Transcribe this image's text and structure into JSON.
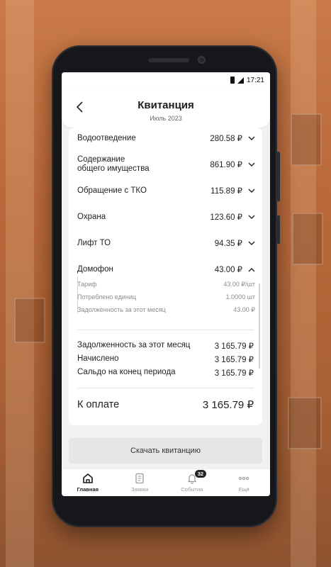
{
  "status_bar": {
    "time": "17:21"
  },
  "header": {
    "title": "Квитанция",
    "subtitle": "Июль 2023"
  },
  "services": [
    {
      "label": "Водоотведение",
      "amount": "280.58 ₽"
    },
    {
      "label": "Содержание\nобщего имущества",
      "amount": "861.90 ₽"
    },
    {
      "label": "Обращение с ТКО",
      "amount": "115.89 ₽"
    },
    {
      "label": "Охрана",
      "amount": "123.60 ₽"
    },
    {
      "label": "Лифт ТО",
      "amount": "94.35 ₽"
    },
    {
      "label": "Домофон",
      "amount": "43.00 ₽",
      "expanded": true
    }
  ],
  "details": [
    {
      "label": "Тариф",
      "value": "43.00 ₽/шт"
    },
    {
      "label": "Потреблено единиц",
      "value": "1.0000 шт"
    },
    {
      "label": "Задолженность за этот месяц",
      "value": "43.00 ₽"
    }
  ],
  "summary": [
    {
      "label": "Задолженность за этот месяц",
      "value": "3 165.79 ₽"
    },
    {
      "label": "Начислено",
      "value": "3 165.79 ₽"
    },
    {
      "label": "Сальдо на конец периода",
      "value": "3 165.79 ₽"
    }
  ],
  "total": {
    "label": "К оплате",
    "value": "3 165.79 ₽"
  },
  "download_label": "Скачать квитанцию",
  "tabs": [
    {
      "label": "Главная",
      "icon": "home-icon",
      "active": true
    },
    {
      "label": "Заявки",
      "icon": "document-icon"
    },
    {
      "label": "События",
      "icon": "bell-icon",
      "badge": "32"
    },
    {
      "label": "Ещё",
      "icon": "more-icon"
    }
  ]
}
